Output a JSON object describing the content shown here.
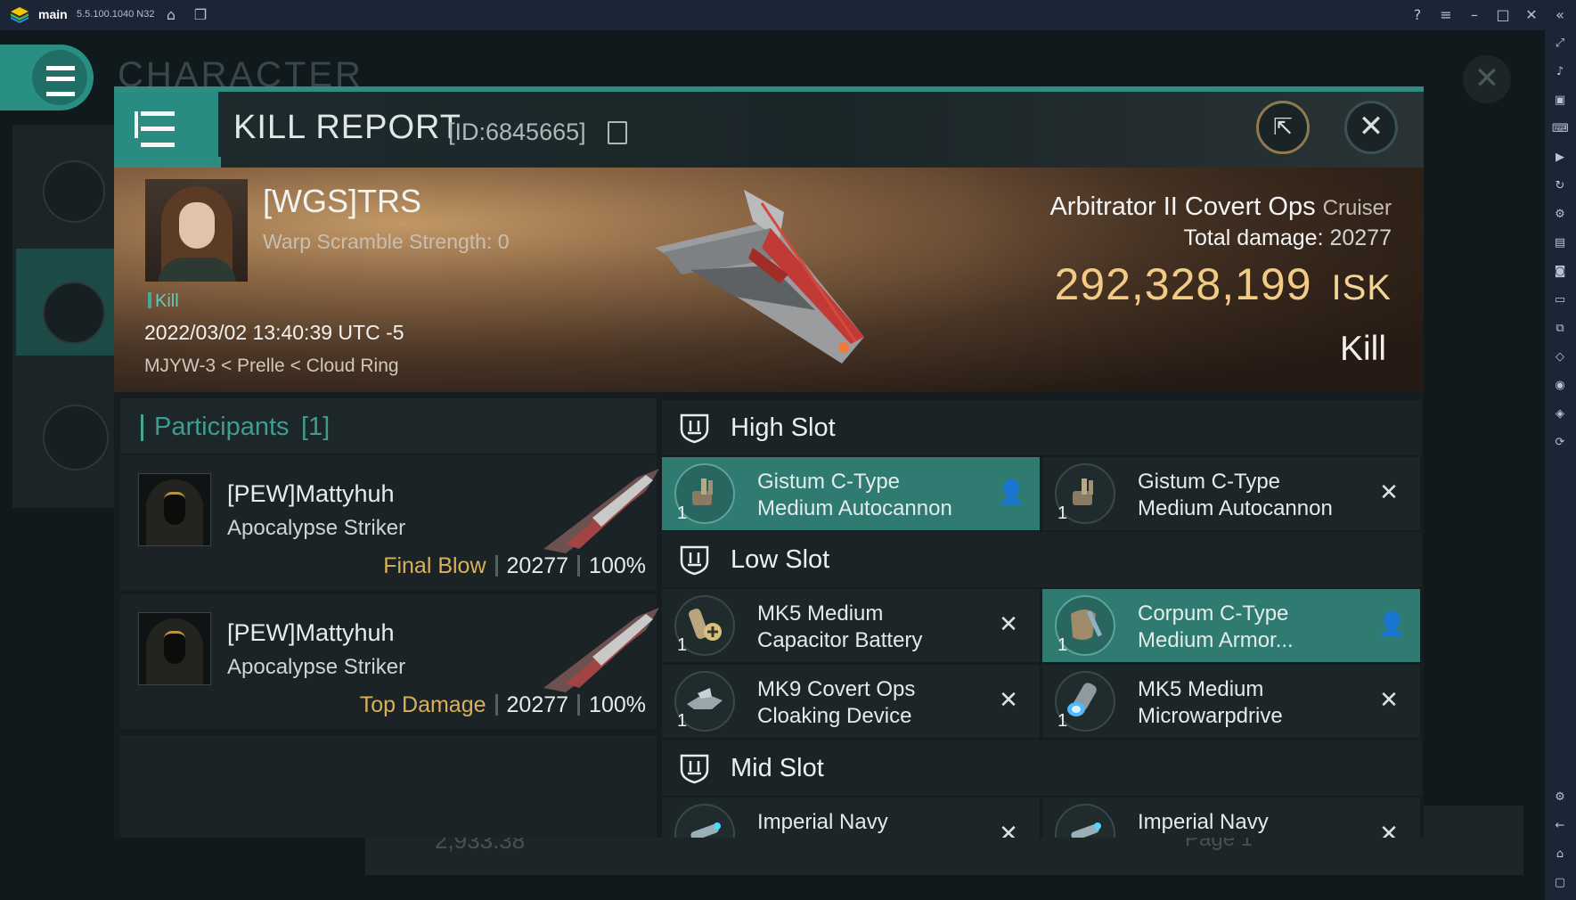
{
  "emulator": {
    "app_name": "main",
    "version": "5.5.100.1040 N32",
    "icons": [
      "home-icon",
      "multi-window-icon",
      "help-icon",
      "menu-icon",
      "minimize-icon",
      "maximize-icon",
      "close-icon",
      "collapse-sidebar-icon"
    ],
    "sidebar_icons": [
      "fullscreen-icon",
      "volume-icon",
      "screen-record-icon",
      "keyboard-icon",
      "macro-icon",
      "sync-icon",
      "controller-icon",
      "apk-icon",
      "screenshot-icon",
      "folder-icon",
      "multi-instance-icon",
      "eco-mode-icon",
      "location-icon",
      "layers-icon",
      "rotate-icon",
      "settings-icon",
      "back-icon",
      "home-icon",
      "recent-apps-icon"
    ]
  },
  "background": {
    "page_title": "CHARACTER",
    "amount": "2,933.38",
    "page_label": "Page 1"
  },
  "header": {
    "title": "KILL REPORT",
    "report_id": "[ID:6845665]"
  },
  "victim": {
    "name": "[WGS]TRS",
    "warp_scramble": "Warp Scramble Strength: 0",
    "tag": "Kill",
    "timestamp": "2022/03/02 13:40:39 UTC -5",
    "location": "MJYW-3 < Prelle < Cloud Ring",
    "ship": "Arbitrator II Covert Ops",
    "ship_class": "Cruiser",
    "total_damage_label": "Total damage:",
    "total_damage": "20277",
    "isk_value": "292,328,199",
    "isk_unit": "ISK",
    "result": "Kill"
  },
  "participants": {
    "title": "Participants",
    "count": "[1]",
    "rows": [
      {
        "name": "[PEW]Mattyhuh",
        "ship": "Apocalypse Striker",
        "role": "Final Blow",
        "damage": "20277",
        "percent": "100%"
      },
      {
        "name": "[PEW]Mattyhuh",
        "ship": "Apocalypse Striker",
        "role": "Top Damage",
        "damage": "20277",
        "percent": "100%"
      }
    ]
  },
  "slots": {
    "high": {
      "label": "High Slot",
      "items": [
        {
          "line1": "Gistum C-Type",
          "line2": "Medium Autocannon",
          "qty": "1",
          "icon": "autocannon-icon",
          "action": "person-icon",
          "highlighted": true
        },
        {
          "line1": "Gistum C-Type",
          "line2": "Medium Autocannon",
          "qty": "1",
          "icon": "autocannon-icon",
          "action": "destroyed-x-icon",
          "highlighted": false
        }
      ]
    },
    "low": {
      "label": "Low Slot",
      "items": [
        {
          "line1": "MK5 Medium",
          "line2": "Capacitor Battery",
          "qty": "1",
          "icon": "capacitor-battery-icon",
          "action": "destroyed-x-icon",
          "highlighted": false
        },
        {
          "line1": "Corpum C-Type",
          "line2": "Medium Armor...",
          "qty": "1",
          "icon": "armor-repairer-icon",
          "action": "person-icon",
          "highlighted": true
        },
        {
          "line1": "MK9 Covert Ops",
          "line2": "Cloaking Device",
          "qty": "1",
          "icon": "cloaking-device-icon",
          "action": "destroyed-x-icon",
          "highlighted": false
        },
        {
          "line1": "MK5 Medium",
          "line2": "Microwarpdrive",
          "qty": "1",
          "icon": "microwarpdrive-icon",
          "action": "destroyed-x-icon",
          "highlighted": false
        }
      ]
    },
    "mid": {
      "label": "Mid Slot",
      "items": [
        {
          "line1": "Imperial Navy",
          "line2": "",
          "qty": "",
          "icon": "module-icon",
          "action": "destroyed-x-icon",
          "highlighted": false
        },
        {
          "line1": "Imperial Navy",
          "line2": "",
          "qty": "",
          "icon": "module-icon",
          "action": "destroyed-x-icon",
          "highlighted": false
        }
      ]
    }
  },
  "colors": {
    "accent_teal": "#2f8c82",
    "isk_gold": "#f2cb85",
    "role_gold": "#d9b15a"
  }
}
